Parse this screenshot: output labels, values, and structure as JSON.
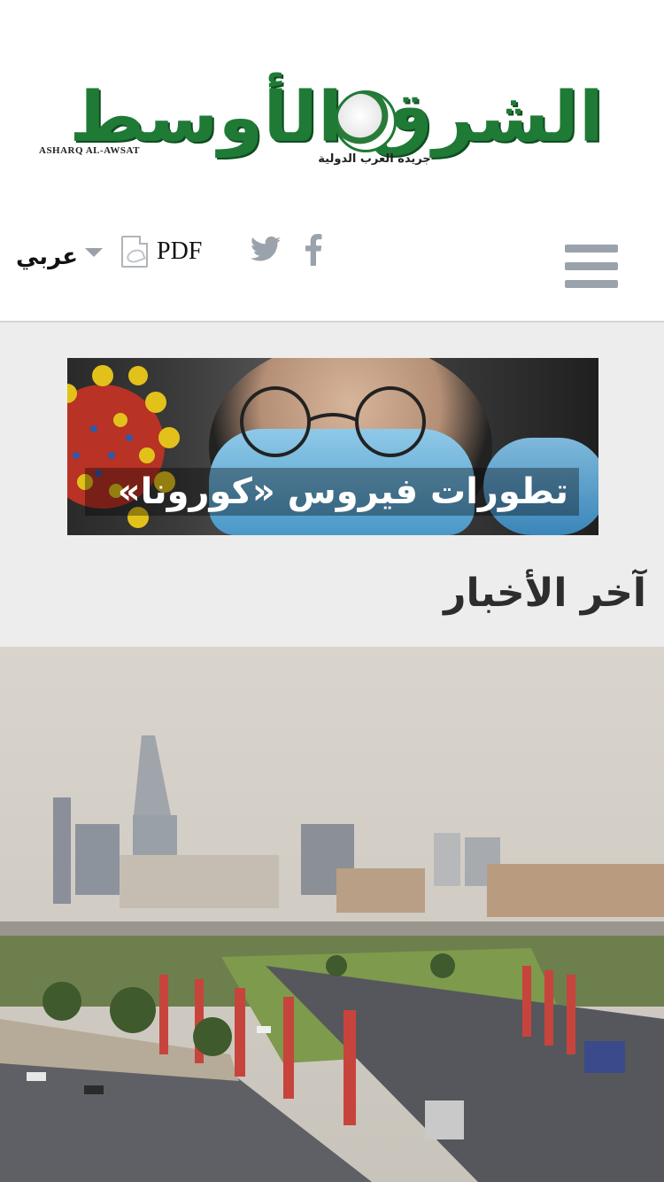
{
  "masthead": {
    "logo_ar": "الشرق الأوسط",
    "logo_en": "ASHARQ AL-AWSAT",
    "logo_tagline": "جريدة العرب الدولية"
  },
  "toolbar": {
    "language_label": "عربي",
    "pdf_label": "PDF",
    "icons": [
      "facebook-icon",
      "twitter-icon",
      "pdf-icon",
      "menu-icon",
      "caret-icon"
    ]
  },
  "banner": {
    "caption": "تطورات فيروس «كورونا»"
  },
  "main": {
    "section_title": "آخر الأخبار"
  },
  "colors": {
    "brand_green": "#1f7a36",
    "icon_grey": "#9aa3ab",
    "content_bg": "#ededed"
  }
}
